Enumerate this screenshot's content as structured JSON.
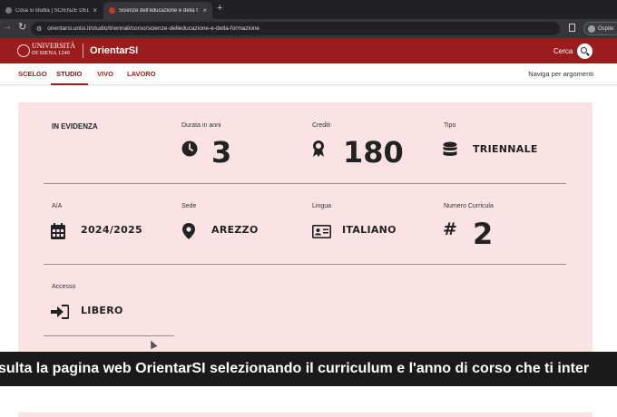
{
  "browser": {
    "tabs": [
      {
        "title": "Cosa si studia | SCIENZE DELL'E",
        "active": false
      },
      {
        "title": "Scienze dell'educazione e della f",
        "active": true
      }
    ],
    "new_tab": "+",
    "close": "×",
    "url": "orientarsi.unisi.it/studio/triennali/corso/scienze-delleducazione-e-della-formazione",
    "profile": "Ospite"
  },
  "site": {
    "university_line1": "UNIVERSITÀ",
    "university_line2": "DI SIENA 1240",
    "brand": "OrientarSI",
    "search_label": "Cerca",
    "brand_color": "#9b1c1c"
  },
  "subnav": {
    "items": [
      "SCELGO",
      "STUDIO",
      "VIVO",
      "LAVORO"
    ],
    "active": "STUDIO",
    "right": "Naviga per argomenti"
  },
  "panel": {
    "background": "#fbe3e3",
    "in_evidenza": "IN EVIDENZA",
    "durata": {
      "label": "Durata in anni",
      "value": "3",
      "icon": "clock-icon"
    },
    "crediti": {
      "label": "Crediti",
      "value": "180",
      "icon": "award-icon"
    },
    "tipo": {
      "label": "Tipo",
      "value": "TRIENNALE",
      "icon": "database-icon"
    },
    "aa": {
      "label": "A/A",
      "value": "2024/2025",
      "icon": "calendar-icon"
    },
    "sede": {
      "label": "Sede",
      "value": "AREZZO",
      "icon": "map-pin-icon"
    },
    "lingua": {
      "label": "Lingua",
      "value": "ITALIANO",
      "icon": "id-card-icon"
    },
    "curricula": {
      "label": "Numero Curricula",
      "value": "2",
      "icon": "#"
    },
    "accesso": {
      "label": "Accesso",
      "value": "LIBERO",
      "icon": "sign-in-icon"
    }
  },
  "caption": "sulta la pagina web OrientarSI selezionando il curriculum e l'anno di corso che ti inter"
}
